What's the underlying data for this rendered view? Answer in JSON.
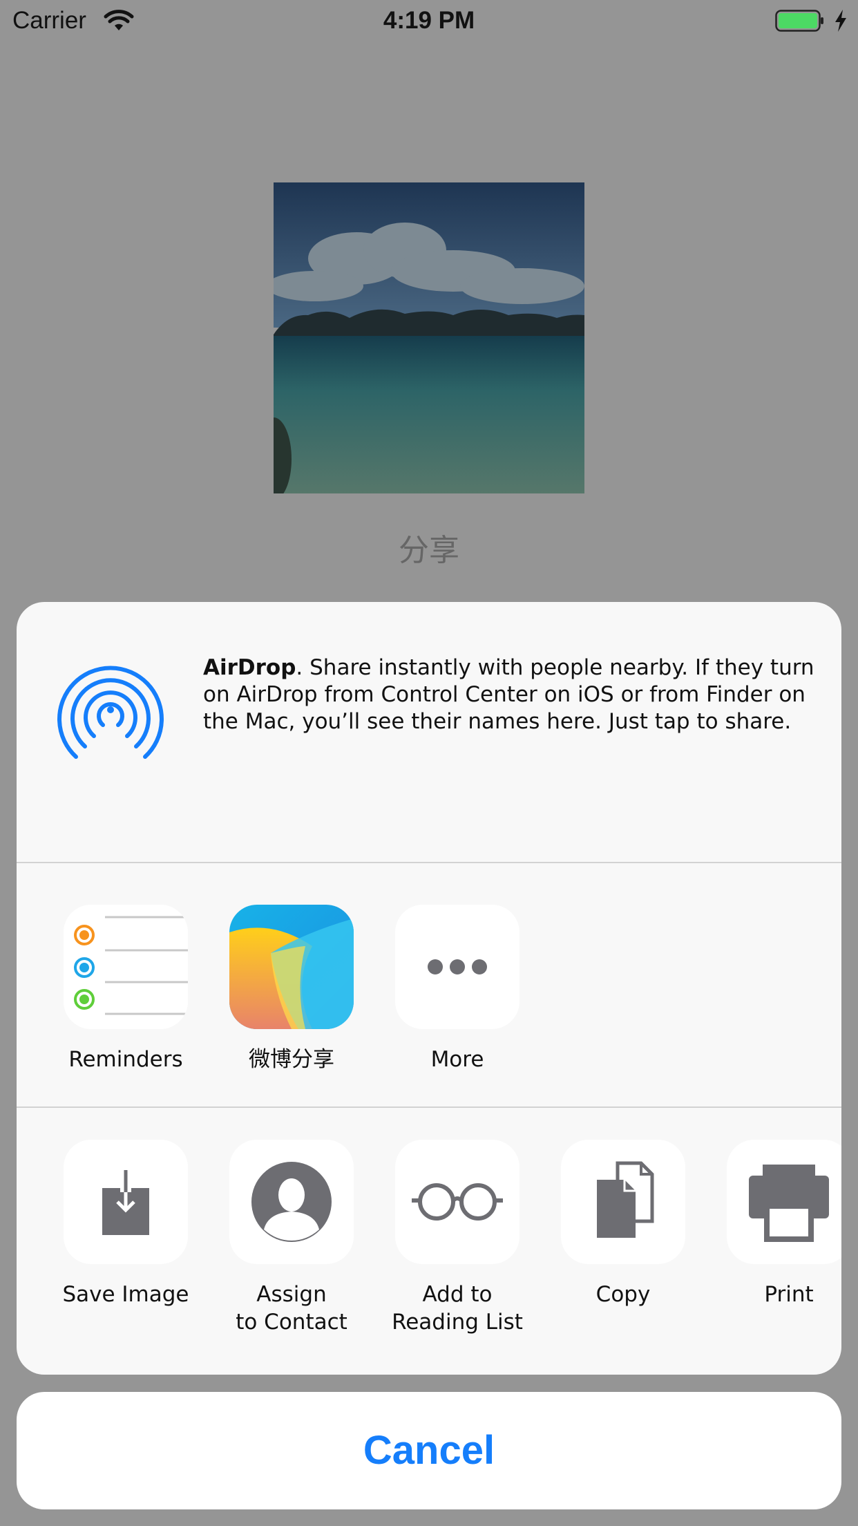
{
  "status_bar": {
    "carrier": "Carrier",
    "time": "4:19 PM",
    "battery_color": "#4cd964"
  },
  "content": {
    "share_label": "分享"
  },
  "airdrop": {
    "title": "AirDrop",
    "description": ". Share instantly with people nearby. If they turn on AirDrop from Control Center on iOS or from Finder on the Mac, you’ll see their names here. Just tap to share.",
    "icon": "airdrop-icon",
    "accent": "#157efb"
  },
  "apps": [
    {
      "label": "Reminders",
      "icon": "reminders-icon"
    },
    {
      "label": "微博分享",
      "icon": "weibo-share-icon"
    },
    {
      "label": "More",
      "icon": "more-icon"
    }
  ],
  "actions": [
    {
      "label": "Save Image",
      "icon": "save-image-icon"
    },
    {
      "label": "Assign\nto Contact",
      "line1": "Assign",
      "line2": "to Contact",
      "icon": "contact-icon"
    },
    {
      "label": "Add to\nReading List",
      "line1": "Add to",
      "line2": "Reading List",
      "icon": "glasses-icon"
    },
    {
      "label": "Copy",
      "icon": "copy-icon"
    },
    {
      "label": "Print",
      "icon": "print-icon"
    }
  ],
  "cancel_label": "Cancel"
}
